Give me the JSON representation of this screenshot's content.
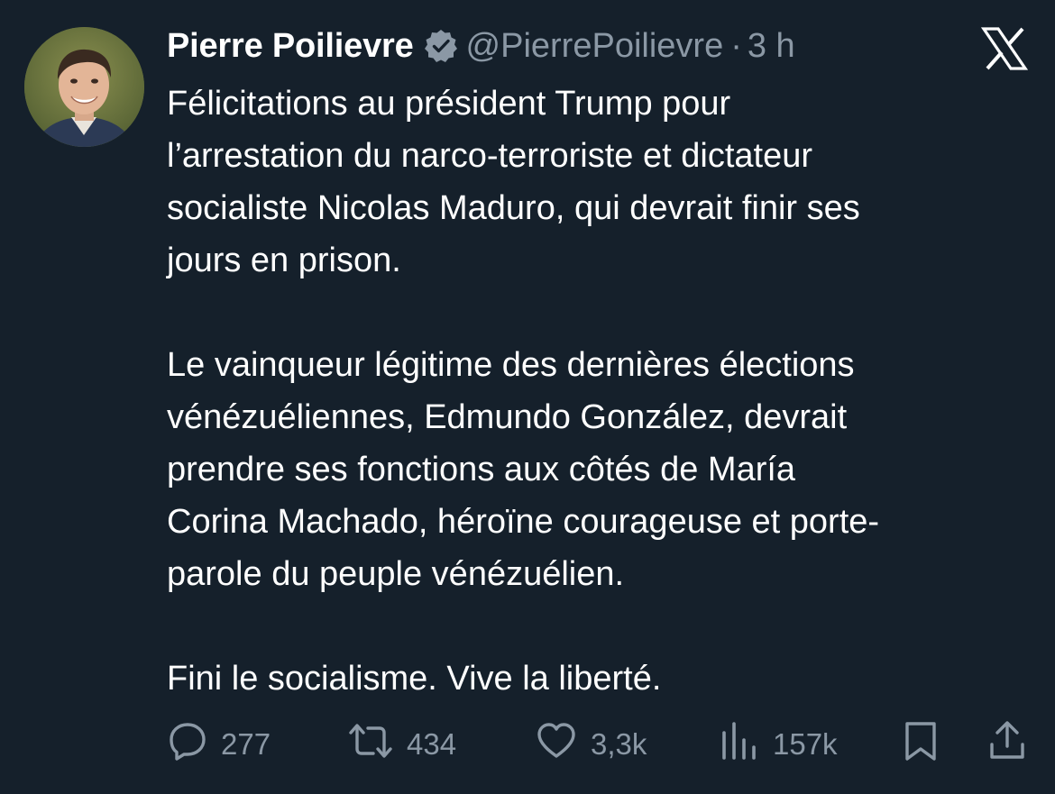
{
  "tweet": {
    "display_name": "Pierre Poilievre",
    "handle": "@PierrePoilievre",
    "separator": "·",
    "time": "3 h",
    "paragraphs": [
      "Félicitations au président Trump pour\nl’arrestation du narco-terroriste et dictateur\nsocialiste Nicolas Maduro, qui devrait finir ses\njours en prison.",
      "Le vainqueur légitime des dernières élections\nvénézuéliennes, Edmundo González, devrait\nprendre ses fonctions aux côtés de María\nCorina Machado, héroïne courageuse et porte-\nparole du peuple vénézuélien.",
      "Fini le socialisme. Vive la liberté."
    ]
  },
  "actions": {
    "replies": "277",
    "reposts": "434",
    "likes": "3,3k",
    "views": "157k"
  },
  "icons": {
    "verified": "verified-badge-icon",
    "logo": "x-logo-icon",
    "reply": "reply-icon",
    "repost": "repost-icon",
    "like": "heart-icon",
    "views": "views-icon",
    "bookmark": "bookmark-icon",
    "share": "share-icon"
  },
  "colors": {
    "background": "#15202b",
    "text": "#ffffff",
    "secondary_text": "#8b98a5"
  }
}
